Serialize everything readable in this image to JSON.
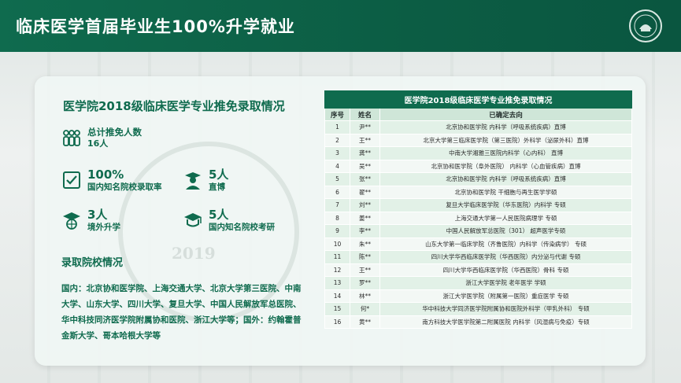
{
  "header": {
    "title": "临床医学首届毕业生100%升学就业"
  },
  "left": {
    "title": "医学院2018级临床医学专业推免录取情况",
    "total_label": "总计推免人数",
    "total_value": "16人",
    "rate_value": "100%",
    "rate_label": "国内知名院校录取率",
    "direct_value": "5人",
    "direct_label": "直博",
    "abroad_value": "3人",
    "abroad_label": "境外升学",
    "exam_value": "5人",
    "exam_label": "国内知名院校考研",
    "admit_title": "录取院校情况",
    "admit_text": "国内：北京协和医学院、上海交通大学、北京大学第三医院、中南大学、山东大学、四川大学、复旦大学、中国人民解放军总医院、华中科技同济医学院附属协和医院、浙江大学等；国外：约翰霍普金斯大学、哥本哈根大学等"
  },
  "table": {
    "caption": "医学院2018级临床医学专业推免录取情况",
    "headers": [
      "序号",
      "姓名",
      "已确定去向"
    ],
    "rows": [
      [
        "1",
        "尹**",
        "北京协和医学院 内科学（呼吸系统疾病）直博"
      ],
      [
        "2",
        "王**",
        "北京大学第三临床医学院（第三医院）外科学（泌尿外科）直博"
      ],
      [
        "3",
        "龚**",
        "中南大学湘雅三医院内科学（心内科） 直博"
      ],
      [
        "4",
        "吴**",
        "北京协和医学院（阜外医院） 内科学（心血管疾病）直博"
      ],
      [
        "5",
        "张**",
        "北京协和医学院 内科学（呼吸系统疾病）直博"
      ],
      [
        "6",
        "翟**",
        "北京协和医学院 干细胞与再生医学学硕"
      ],
      [
        "7",
        "刘**",
        "复旦大学临床医学院（华东医院）内科学 专硕"
      ],
      [
        "8",
        "姜**",
        "上海交通大学第一人民医院病理学 专硕"
      ],
      [
        "9",
        "李**",
        "中国人民解放军总医院（301） 超声医学专硕"
      ],
      [
        "10",
        "朱**",
        "山东大学第一临床学院（齐鲁医院）内科学（传染病学） 专硕"
      ],
      [
        "11",
        "陈**",
        "四川大学华西临床医学院（华西医院）内分泌与代谢 专硕"
      ],
      [
        "12",
        "王**",
        "四川大学华西临床医学院（华西医院）骨科 专硕"
      ],
      [
        "13",
        "罗**",
        "浙江大学医学院 老年医学 学硕"
      ],
      [
        "14",
        "林**",
        "浙江大学医学院（附属第一医院）重症医学 专硕"
      ],
      [
        "15",
        "何*",
        "华中科技大学同济医学院附属协和医院外科学（甲乳外科） 专硕"
      ],
      [
        "16",
        "黄**",
        "南方科技大学医学院第二附属医院 内科学（风湿病与免疫）专硕"
      ]
    ]
  },
  "icons": [
    "people-icon",
    "check-icon",
    "graduate-icon",
    "mortarboard-globe-icon",
    "mortarboard-icon",
    "logo-icon"
  ],
  "colors": {
    "brand_green": "#0f6b4e",
    "header_row": "#cfe6d8",
    "row_odd": "#e2f1e7",
    "row_even": "#f3f8f5"
  }
}
